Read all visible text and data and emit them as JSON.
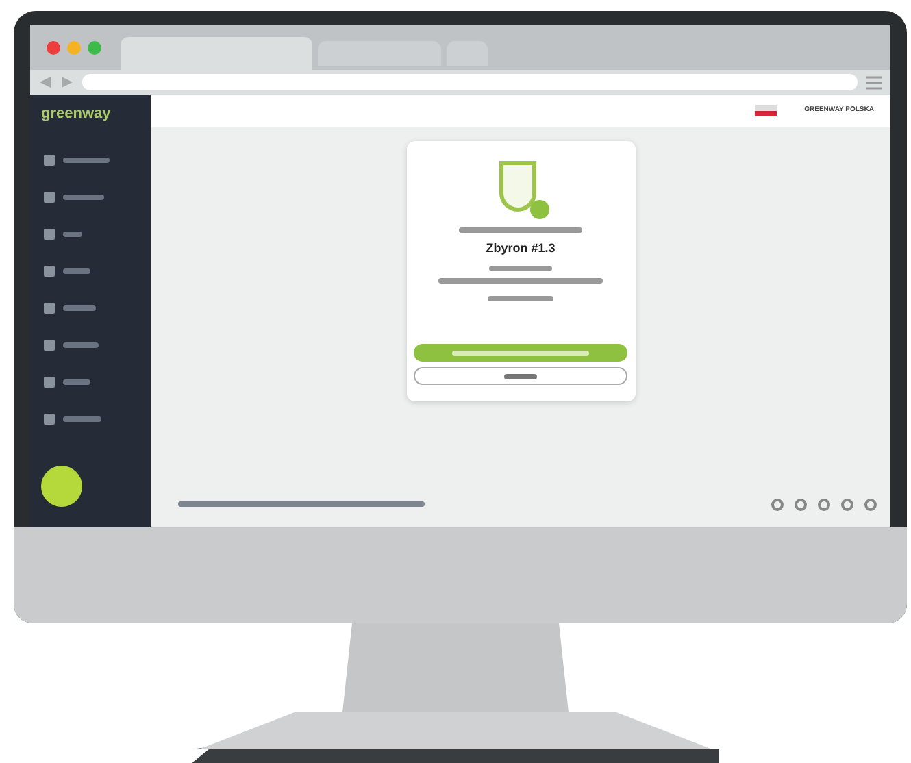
{
  "browser": {
    "tabs": [
      {
        "selected": true
      },
      {
        "selected": false
      },
      {
        "selected": false
      }
    ]
  },
  "app": {
    "logo": "greenway",
    "account": "GREENWAY POLSKA",
    "card": {
      "title": "Zbyron #1.3"
    }
  }
}
